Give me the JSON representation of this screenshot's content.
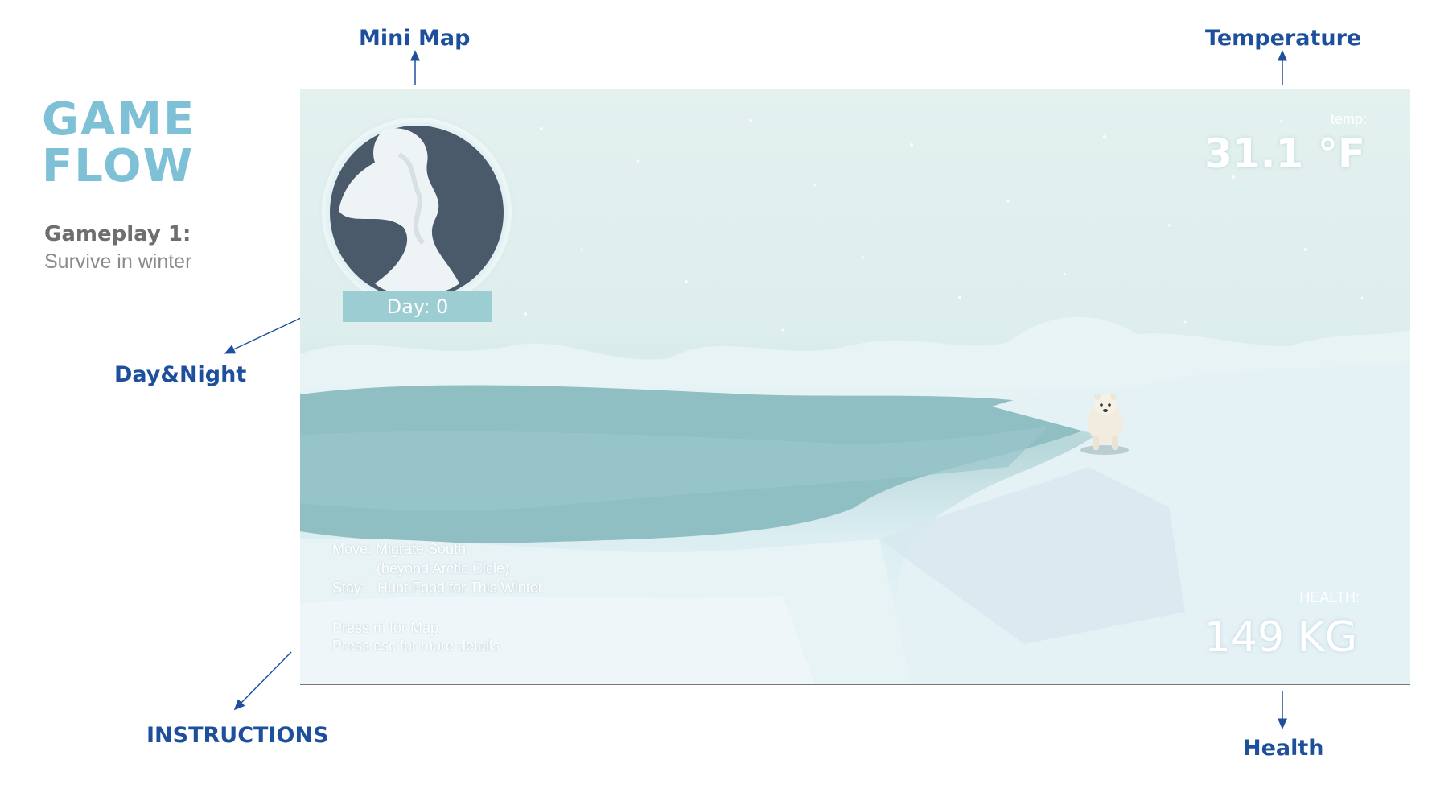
{
  "heading": {
    "line1": "GAME",
    "line2": "FLOW"
  },
  "gameplay": {
    "title": "Gameplay 1:",
    "subtitle": "Survive in winter"
  },
  "callouts": {
    "mini_map": "Mini Map",
    "temperature": "Temperature",
    "day_night": "Day&Night",
    "instructions": "INSTRUCTIONS",
    "health": "Health"
  },
  "hud": {
    "day": "Day: 0",
    "temp_label": "temp:",
    "temp_value": "31.1 °F",
    "health_label": "HEALTH:",
    "health_value": "149  KG",
    "instructions": {
      "line1": "Move: Migrate South",
      "line2": "(beyond Arctic Cicle)",
      "line3": "Stay:   Hunt Food for This Winter",
      "line4": "Press m for Map",
      "line5": "Press esc for more details"
    }
  },
  "colors": {
    "accent_title": "#7ec0d6",
    "callout": "#1d4f9c",
    "day_box": "#9ccdd3"
  }
}
